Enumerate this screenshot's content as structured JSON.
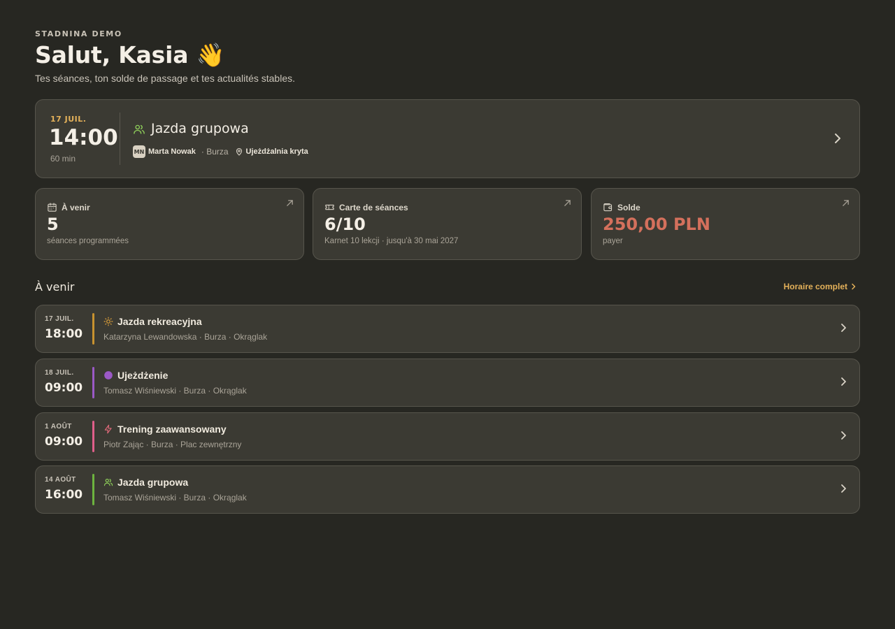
{
  "header": {
    "brand": "STADNINA DEMO",
    "greeting": "Salut, Kasia 👋",
    "subtitle": "Tes séances, ton solde de passage et tes actualités stables."
  },
  "next_session": {
    "date": "17 JUIL.",
    "time": "14:00",
    "duration": "60 min",
    "title": "Jazda grupowa",
    "icon": "users-icon",
    "instructor_initials": "MN",
    "instructor": "Marta Nowak",
    "horse": "· Burza",
    "arena": "Ujeżdżalnia kryta"
  },
  "stats": [
    {
      "icon": "calendar-icon",
      "label": "À venir",
      "value": "5",
      "sub": "séances programmées"
    },
    {
      "icon": "ticket-icon",
      "label": "Carte de séances",
      "value": "6/10",
      "sub": "Karnet 10 lekcji · jusqu'à 30 mai 2027"
    },
    {
      "icon": "wallet-icon",
      "label": "Solde",
      "value": "250,00 PLN",
      "sub": "payer",
      "value_color": "#d4705c"
    }
  ],
  "upcoming": {
    "title": "À venir",
    "link": "Horaire complet",
    "items": [
      {
        "date": "17 JUIL.",
        "time": "18:00",
        "title": "Jazda rekreacyjna",
        "meta": "Katarzyna Lewandowska · Burza · Okrąglak",
        "color": "#c8922f",
        "icon": "sun-icon"
      },
      {
        "date": "18 JUIL.",
        "time": "09:00",
        "title": "Ujeżdżenie",
        "meta": "Tomasz Wiśniewski · Burza · Okrąglak",
        "color": "#9b59c6",
        "icon": "circle-icon"
      },
      {
        "date": "1 AOÛT",
        "time": "09:00",
        "title": "Trening zaawansowany",
        "meta": "Piotr Zając · Burza · Plac zewnętrzny",
        "color": "#e05f8a",
        "icon": "lightning-icon"
      },
      {
        "date": "14 AOÛT",
        "time": "16:00",
        "title": "Jazda grupowa",
        "meta": "Tomasz Wiśniewski · Burza · Okrąglak",
        "color": "#6db33f",
        "icon": "users-icon"
      }
    ]
  },
  "colors": {
    "background": "#272722",
    "card": "#3b3a33",
    "accent": "#e4b15a",
    "negative": "#d4705c"
  }
}
